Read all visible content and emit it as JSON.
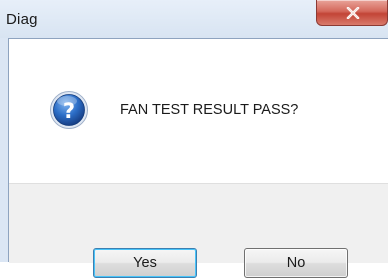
{
  "window": {
    "title": "Diag",
    "close_icon": "close-x-icon"
  },
  "message": {
    "icon": "question-icon",
    "text": "FAN TEST RESULT PASS?"
  },
  "buttons": {
    "yes_label": "Yes",
    "no_label": "No"
  },
  "colors": {
    "close_button": "#c24436",
    "default_button_border": "#3c7fb1",
    "question_icon": "#1e5fb4"
  }
}
